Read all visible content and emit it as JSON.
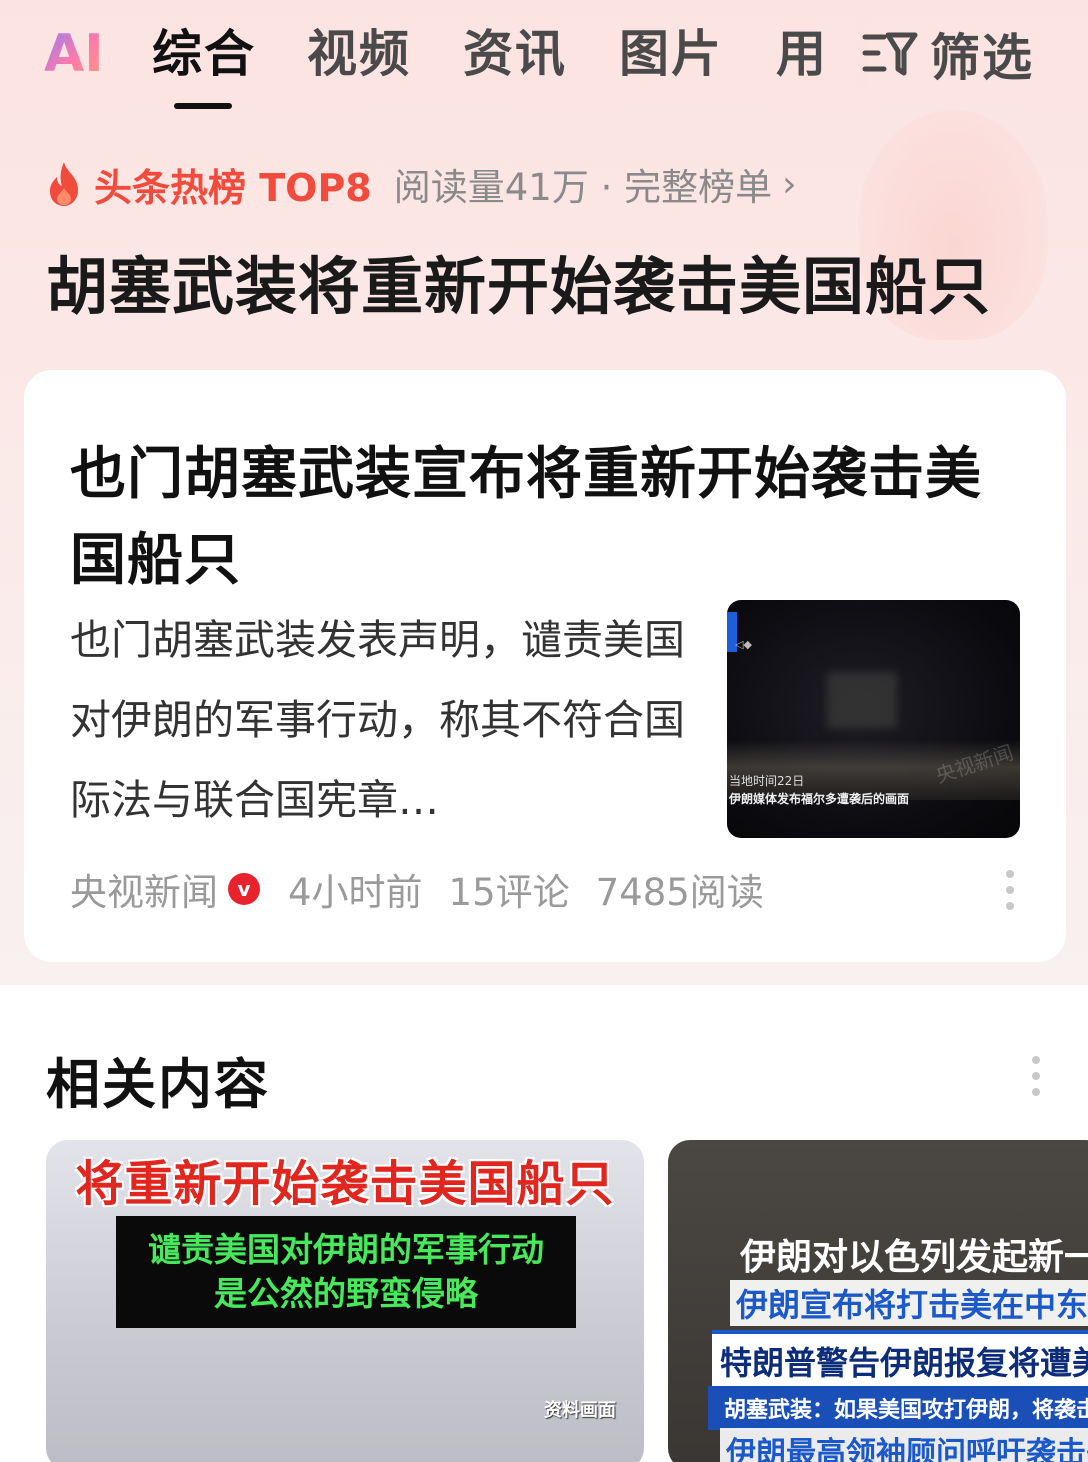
{
  "tabs": {
    "ai": "AI",
    "items": [
      "综合",
      "视频",
      "资讯",
      "图片",
      "用"
    ],
    "active_index": 0,
    "filter_label": "筛选"
  },
  "hot": {
    "label": "头条热榜 TOP8",
    "meta": "阅读量41万 · 完整榜单",
    "chevron": "›",
    "topic_title": "胡塞武装将重新开始袭击美国船只"
  },
  "article": {
    "title": "也门胡塞武装宣布将重新开始袭击美国船只",
    "description": "也门胡塞武装发表声明，谴责美国对伊朗的军事行动，称其不符合国际法与联合国宪章…",
    "source": "央视新闻",
    "verified_badge": "v",
    "time": "4小时前",
    "comments": "15评论",
    "reads": "7485阅读",
    "thumbnail": {
      "caption_line1": "当地时间22日",
      "caption_line2": "伊朗媒体发布福尔多遭袭后的画面",
      "watermark": "央视新闻"
    }
  },
  "related": {
    "title": "相关内容",
    "card1": {
      "headline": "将重新开始袭击美国船只",
      "box_line1": "谴责美国对伊朗的军事行动",
      "box_line2": "是公然的野蛮侵略",
      "source_tag": "资料画面"
    },
    "card2": {
      "line1": "伊朗对以色列发起新一",
      "line2": "伊朗宣布将打击美在中东",
      "line3": "特朗普警告伊朗报复将遭美",
      "line4": "胡塞武装：如果美国攻打伊朗，将袭击",
      "line5": "伊朗最高领袖顾问呼吁袭击美"
    }
  },
  "colors": {
    "accent_red": "#f04b3c",
    "badge_red": "#e8232d",
    "background_top": "#fbe3e1"
  }
}
